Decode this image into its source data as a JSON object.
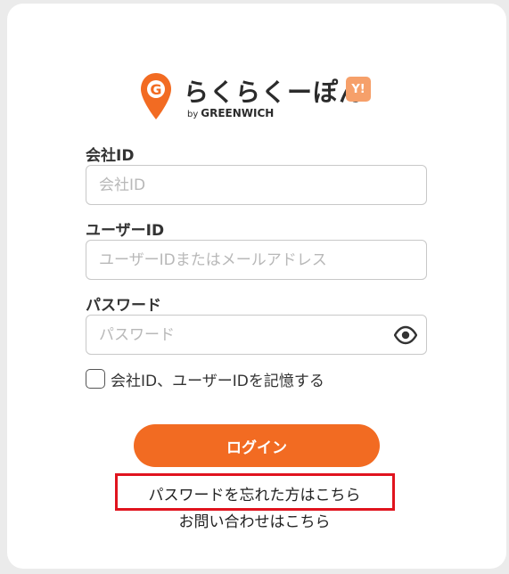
{
  "logo": {
    "brand_text": "らくらくーぽん",
    "badge_text": "Y!",
    "by_prefix": "by",
    "by_name": "GREENWICH",
    "pin_letter": "G"
  },
  "form": {
    "company_id": {
      "label": "会社ID",
      "placeholder": "会社ID",
      "value": ""
    },
    "user_id": {
      "label": "ユーザーID",
      "placeholder": "ユーザーIDまたはメールアドレス",
      "value": ""
    },
    "password": {
      "label": "パスワード",
      "placeholder": "パスワード",
      "value": "",
      "toggle_icon": "eye-icon"
    },
    "remember": {
      "label": "会社ID、ユーザーIDを記憶する",
      "checked": false
    }
  },
  "actions": {
    "login_label": "ログイン",
    "forgot_password_label": "パスワードを忘れた方はこちら",
    "contact_label": "お問い合わせはこちら"
  },
  "colors": {
    "accent": "#f26b22",
    "badge": "#f6a06a",
    "highlight": "#e0141e",
    "background": "#ebebeb"
  }
}
